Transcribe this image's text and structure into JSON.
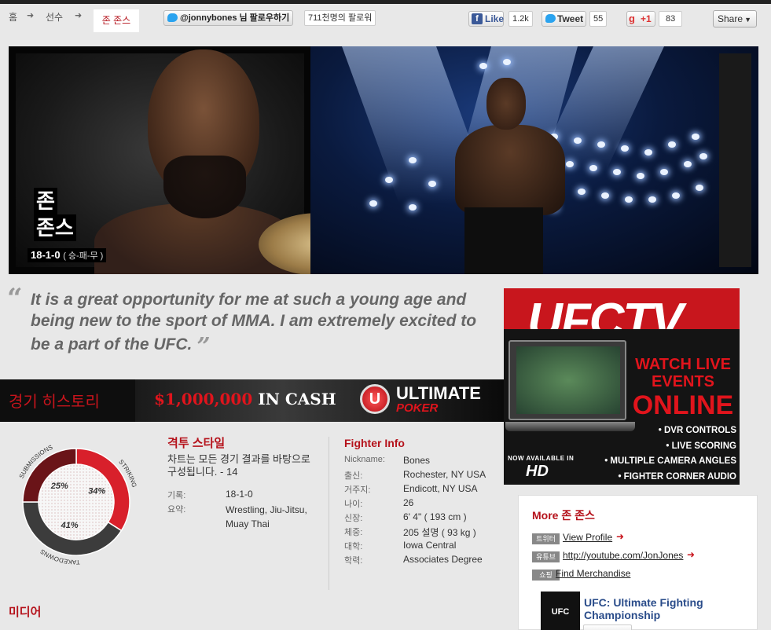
{
  "breadcrumb": {
    "home": "홈",
    "fighters": "선수",
    "current": "존 존스"
  },
  "social": {
    "twitter_follow": "@jonnybones 님 팔로우하기",
    "followers": "711천명의 팔로워",
    "fb_label": "Like",
    "fb_count": "1.2k",
    "tweet_label": "Tweet",
    "tweet_count": "55",
    "gplus_label": "+1",
    "gplus_count": "83",
    "share_label": "Share"
  },
  "hero": {
    "name_first": "존",
    "name_last": "존스",
    "record": "18-1-0",
    "record_note": "( 승-패-무 )"
  },
  "quote": {
    "text": "It is a great opportunity for me at such a young age and being new to the sport of MMA. I am extremely excited to be a part of the UFC."
  },
  "ufc_ad": {
    "logo": "UFCTV",
    "watch_line1": "WATCH LIVE",
    "watch_line2": "EVENTS",
    "watch_line3": "ONLINE",
    "bullets": [
      "• DVR CONTROLS",
      "• LIVE SCORING",
      "• MULTIPLE CAMERA ANGLES",
      "• FIGHTER CORNER AUDIO FEEDS"
    ],
    "now_available": "NOW AVAILABLE IN",
    "hd": "HD"
  },
  "history": {
    "title": "경기 히스토리"
  },
  "poker_ad": {
    "amount": "$1,000,000",
    "in_cash": " IN CASH",
    "logo_letter": "U",
    "brand": "ULTIMATE",
    "brand_sub": "POKER"
  },
  "chart_data": {
    "type": "pie",
    "categories": [
      "STRIKING",
      "TAKEDOWNS",
      "SUBMISSIONS"
    ],
    "values": [
      34,
      41,
      25
    ],
    "labels": [
      "34%",
      "41%",
      "25%"
    ],
    "colors": [
      "#d8202b",
      "#3c3c3c",
      "#6a1418"
    ]
  },
  "fight_style": {
    "title": "격투 스타일",
    "desc": "차트는 모든 경기 결과를 바탕으로 구성됩니다. - 14",
    "record_label": "기록:",
    "record_value": "18-1-0",
    "summary_label": "요약:",
    "summary_value": "Wrestling, Jiu-Jitsu, Muay Thai"
  },
  "fighter_info": {
    "title": "Fighter Info",
    "rows": [
      {
        "label": "Nickname:",
        "value": "Bones"
      },
      {
        "label": "출신:",
        "value": "Rochester, NY USA"
      },
      {
        "label": "거주지:",
        "value": "Endicott, NY USA"
      },
      {
        "label": "나이:",
        "value": "26"
      },
      {
        "label": "신장:",
        "value": "6' 4\" ( 193 cm )"
      },
      {
        "label": "체중:",
        "value": "205 설명 ( 93 kg )"
      },
      {
        "label": "대학:",
        "value": "Iowa Central"
      },
      {
        "label": "학력:",
        "value": "Associates Degree"
      }
    ]
  },
  "media": {
    "title": "미디어"
  },
  "more": {
    "title": "More 존 존스",
    "links": [
      {
        "tag": "트위터",
        "text": "View Profile"
      },
      {
        "tag": "유튜브",
        "text": "http://youtube.com/JonJones"
      },
      {
        "tag": "쇼핑",
        "text": "Find Merchandise"
      }
    ],
    "channel_thumb": "UFC",
    "channel_name": "UFC: Ultimate Fighting Championship"
  }
}
